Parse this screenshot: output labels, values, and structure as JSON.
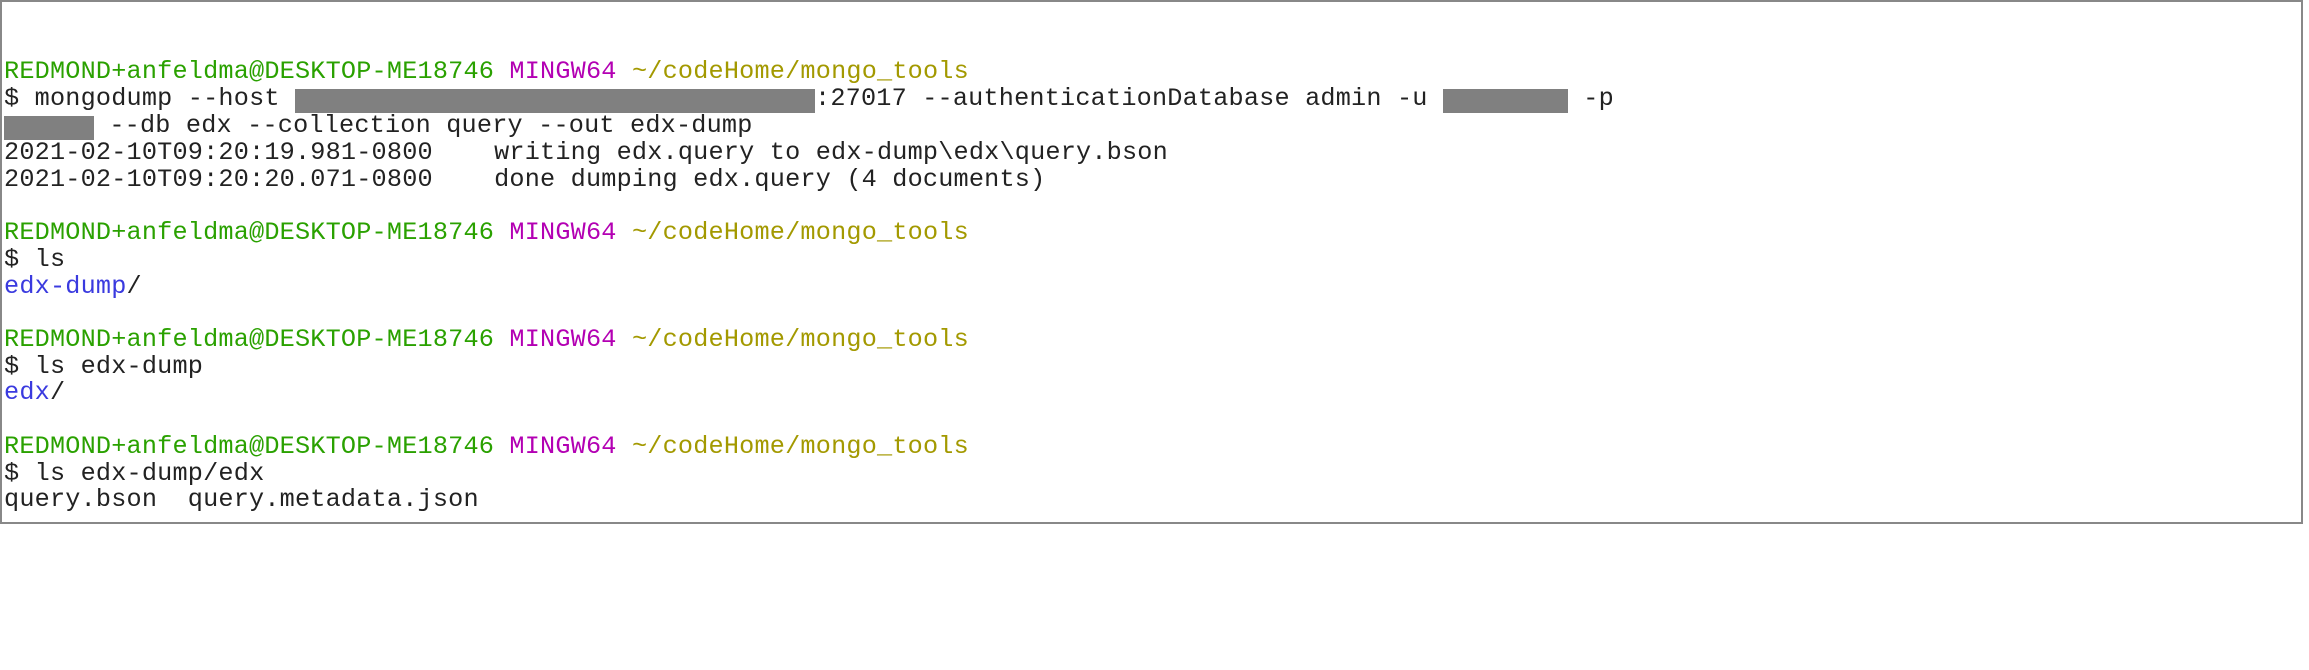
{
  "colors": {
    "user": "#2aa100",
    "mingw": "#b300b3",
    "cwd": "#a39900",
    "dir": "#3a3adf",
    "redact": "#808080"
  },
  "prompt": {
    "user_host": "REDMOND+anfeldma@DESKTOP-ME18746",
    "shell": "MINGW64",
    "cwd": "~/codeHome/mongo_tools",
    "ps1": "$"
  },
  "blocks": [
    {
      "cmd": {
        "parts": [
          {
            "t": "text",
            "v": "mongodump --host "
          },
          {
            "t": "redact",
            "cls": "host"
          },
          {
            "t": "text",
            "v": ":27017 --authenticationDatabase admin -u "
          },
          {
            "t": "redact",
            "cls": "uval"
          },
          {
            "t": "text",
            "v": " -p\n"
          },
          {
            "t": "redact",
            "cls": "pval"
          },
          {
            "t": "text",
            "v": " --db edx --collection query --out edx-dump"
          }
        ]
      },
      "out": [
        {
          "type": "plain",
          "v": "2021-02-10T09:20:19.981-0800    writing edx.query to edx-dump\\edx\\query.bson"
        },
        {
          "type": "plain",
          "v": "2021-02-10T09:20:20.071-0800    done dumping edx.query (4 documents)"
        }
      ]
    },
    {
      "cmd": {
        "parts": [
          {
            "t": "text",
            "v": "ls"
          }
        ]
      },
      "out": [
        {
          "type": "dir",
          "v": "edx-dump",
          "suffix": "/"
        }
      ]
    },
    {
      "cmd": {
        "parts": [
          {
            "t": "text",
            "v": "ls edx-dump"
          }
        ]
      },
      "out": [
        {
          "type": "dir",
          "v": "edx",
          "suffix": "/"
        }
      ]
    },
    {
      "cmd": {
        "parts": [
          {
            "t": "text",
            "v": "ls edx-dump/edx"
          }
        ]
      },
      "out": [
        {
          "type": "plain",
          "v": "query.bson  query.metadata.json"
        }
      ]
    }
  ]
}
